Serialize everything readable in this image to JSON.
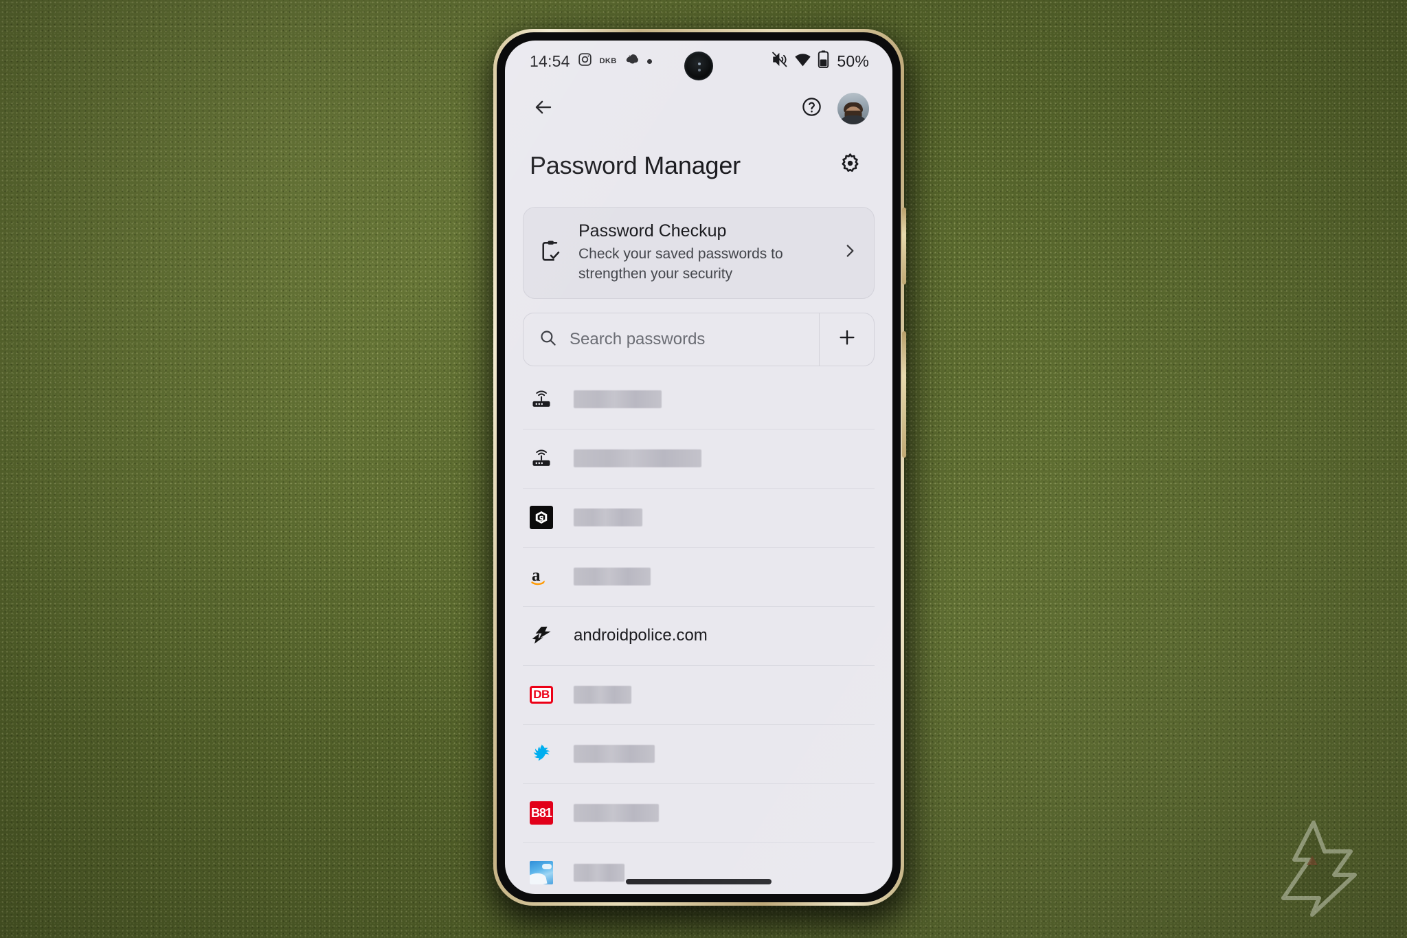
{
  "device": {
    "status_bar": {
      "time": "14:54",
      "icons_left": [
        "instagram-icon",
        "dkb-badge",
        "blob-icon",
        "dot-icon"
      ],
      "dkb_label": "DKB",
      "mute_icon": "volume-off-icon",
      "wifi_icon": "wifi-icon",
      "battery_icon": "battery-icon",
      "battery_percent": "50%"
    },
    "gesture_bar": "home-gesture-bar"
  },
  "app_bar": {
    "back_icon": "back-arrow-icon",
    "help_icon": "help-circle-icon",
    "avatar": "user-avatar"
  },
  "header": {
    "title": "Password Manager",
    "settings_icon": "gear-icon"
  },
  "checkup_card": {
    "icon": "clipboard-check-icon",
    "title": "Password Checkup",
    "subtitle": "Check your saved passwords to strengthen your security",
    "chevron_icon": "chevron-right-icon"
  },
  "search": {
    "icon": "search-icon",
    "placeholder": "Search passwords",
    "value": "",
    "add_icon": "plus-icon",
    "add_label": "+"
  },
  "password_list": [
    {
      "icon": "router-icon",
      "label": "",
      "redacted": true,
      "redact_width": 128
    },
    {
      "icon": "router-icon",
      "label": "",
      "redacted": true,
      "redact_width": 186
    },
    {
      "icon": "ninegag-icon",
      "label": "",
      "redacted": true,
      "redact_width": 100
    },
    {
      "icon": "amazon-icon",
      "label": "",
      "redacted": true,
      "redact_width": 112
    },
    {
      "icon": "androidpolice-icon",
      "label": "androidpolice.com",
      "redacted": false,
      "redact_width": 0
    },
    {
      "icon": "deutschebahn-icon",
      "label": "",
      "redacted": true,
      "redact_width": 84
    },
    {
      "icon": "barclays-icon",
      "label": "",
      "redacted": true,
      "redact_width": 118
    },
    {
      "icon": "b81-icon",
      "label": "",
      "redacted": true,
      "redact_width": 124
    },
    {
      "icon": "sky-photo-icon",
      "label": "",
      "redacted": true,
      "redact_width": 74
    }
  ],
  "icon_labels": {
    "deutschebahn": "DB",
    "b81": "B81"
  },
  "watermark": {
    "name": "android-police-logo"
  },
  "colors": {
    "screen_background": "#e9e8ee",
    "card_background": "#e2e1e8",
    "text_primary": "#1b1b1f",
    "text_secondary": "#43454b",
    "divider": "#dadae1",
    "redaction": "#c2c1c9",
    "phone_frame": "#d9c9a0",
    "backdrop_green": "#5a6a2d",
    "deutschebahn_red": "#ec0016",
    "b81_red": "#e2001a",
    "barclays_blue": "#00aeef",
    "amazon_orange": "#ff9900"
  }
}
